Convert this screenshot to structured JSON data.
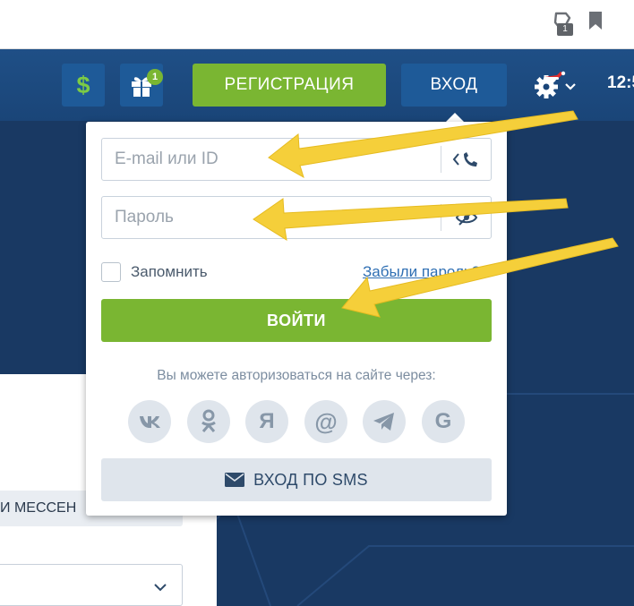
{
  "browser": {
    "extension_badge": "1"
  },
  "header": {
    "currency_symbol": "$",
    "gift_badge": "1",
    "register_label": "РЕГИСТРАЦИЯ",
    "login_label": "ВХОД",
    "time": "12:5"
  },
  "login_form": {
    "email_placeholder": "E-mail или ID",
    "password_placeholder": "Пароль",
    "remember_label": "Запомнить",
    "forgot_label": "Забыли пароль?",
    "submit_label": "ВОЙТИ",
    "social_caption": "Вы можете авторизоваться на сайте через:",
    "social_buttons": [
      {
        "icon": "vk-icon",
        "glyph": "vk"
      },
      {
        "icon": "odnoklassniki-icon",
        "glyph": "ok"
      },
      {
        "icon": "yandex-icon",
        "glyph": "Я"
      },
      {
        "icon": "mail-at-icon",
        "glyph": "@"
      },
      {
        "icon": "telegram-icon",
        "glyph": "tg"
      },
      {
        "icon": "google-icon",
        "glyph": "G"
      }
    ],
    "sms_label": "ВХОД ПО SMS"
  },
  "background_page": {
    "messenger_strip_text": "И МЕССЕН"
  },
  "colors": {
    "accent_green": "#7ab632",
    "header_blue": "#1f4f86",
    "arrow_yellow": "#f5cf3a"
  }
}
